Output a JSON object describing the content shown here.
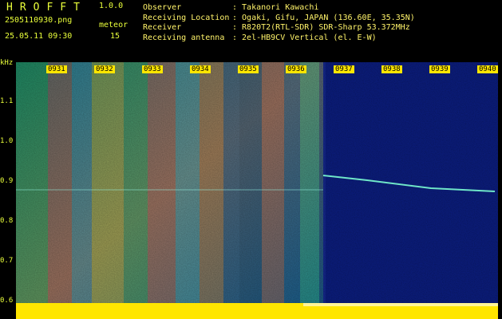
{
  "header": {
    "logo": "HROFFT",
    "version": "1.0.0",
    "filename": "2505110930.png",
    "datetime": "25.05.11 09:30",
    "kind_label": "meteor",
    "count": "15"
  },
  "info": {
    "observer_label": "Observer",
    "observer_value": ": Takanori Kawachi",
    "location_label": "Receiving Location",
    "location_value": ": Ogaki, Gifu, JAPAN (136.60E, 35.35N)",
    "receiver_label": "Receiver",
    "receiver_value": ": R820T2(RTL-SDR) SDR-Sharp 53.372MHz",
    "antenna_label": "Receiving antenna",
    "antenna_value": ": 2el-HB9CV Vertical (el. E-W)"
  },
  "axis": {
    "unit": "kHz",
    "y_labels": [
      "1.1",
      "1.0",
      "0.9",
      "0.8",
      "0.7",
      "0.6"
    ],
    "time_labels": [
      "0931",
      "0932",
      "0933",
      "0934",
      "0935",
      "0936",
      "0937",
      "0938",
      "0939",
      "0940"
    ]
  },
  "colors": {
    "background": "#000000",
    "text": "#eaff3a",
    "tick_bg": "#ffe600"
  }
}
